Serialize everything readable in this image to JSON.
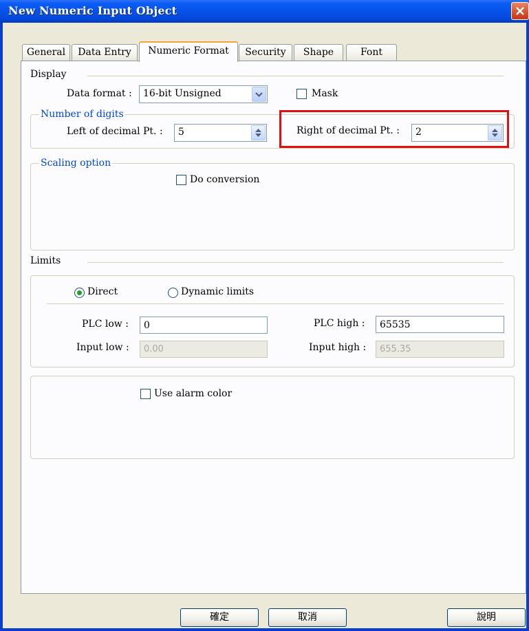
{
  "window": {
    "title": "New  Numeric Input Object"
  },
  "tabs": [
    {
      "label": "General"
    },
    {
      "label": "Data Entry"
    },
    {
      "label": "Numeric Format"
    },
    {
      "label": "Security"
    },
    {
      "label": "Shape"
    },
    {
      "label": "Font"
    }
  ],
  "active_tab": "Numeric Format",
  "display": {
    "section_label": "Display",
    "data_format_label": "Data format :",
    "data_format_value": "16-bit Unsigned",
    "mask_label": "Mask",
    "mask_checked": false
  },
  "digits": {
    "group_label": "Number of digits",
    "left_label": "Left of decimal Pt. :",
    "left_value": "5",
    "right_label": "Right of decimal Pt. :",
    "right_value": "2"
  },
  "scaling": {
    "group_label": "Scaling option",
    "do_conversion_label": "Do conversion",
    "do_conversion_checked": false
  },
  "limits": {
    "section_label": "Limits",
    "direct_label": "Direct",
    "dynamic_label": "Dynamic limits",
    "selected": "Direct",
    "plc_low_label": "PLC low :",
    "plc_low_value": "0",
    "plc_high_label": "PLC high :",
    "plc_high_value": "65535",
    "input_low_label": "Input low :",
    "input_low_value": "0.00",
    "input_high_label": "Input high :",
    "input_high_value": "655.35"
  },
  "alarm": {
    "use_alarm_color_label": "Use alarm color",
    "checked": false
  },
  "buttons": {
    "ok": "確定",
    "cancel": "取消",
    "help": "說明"
  },
  "colors": {
    "title_bar": "#0752e8",
    "highlight": "#e01010",
    "active_tab_accent": "#f6a635"
  }
}
